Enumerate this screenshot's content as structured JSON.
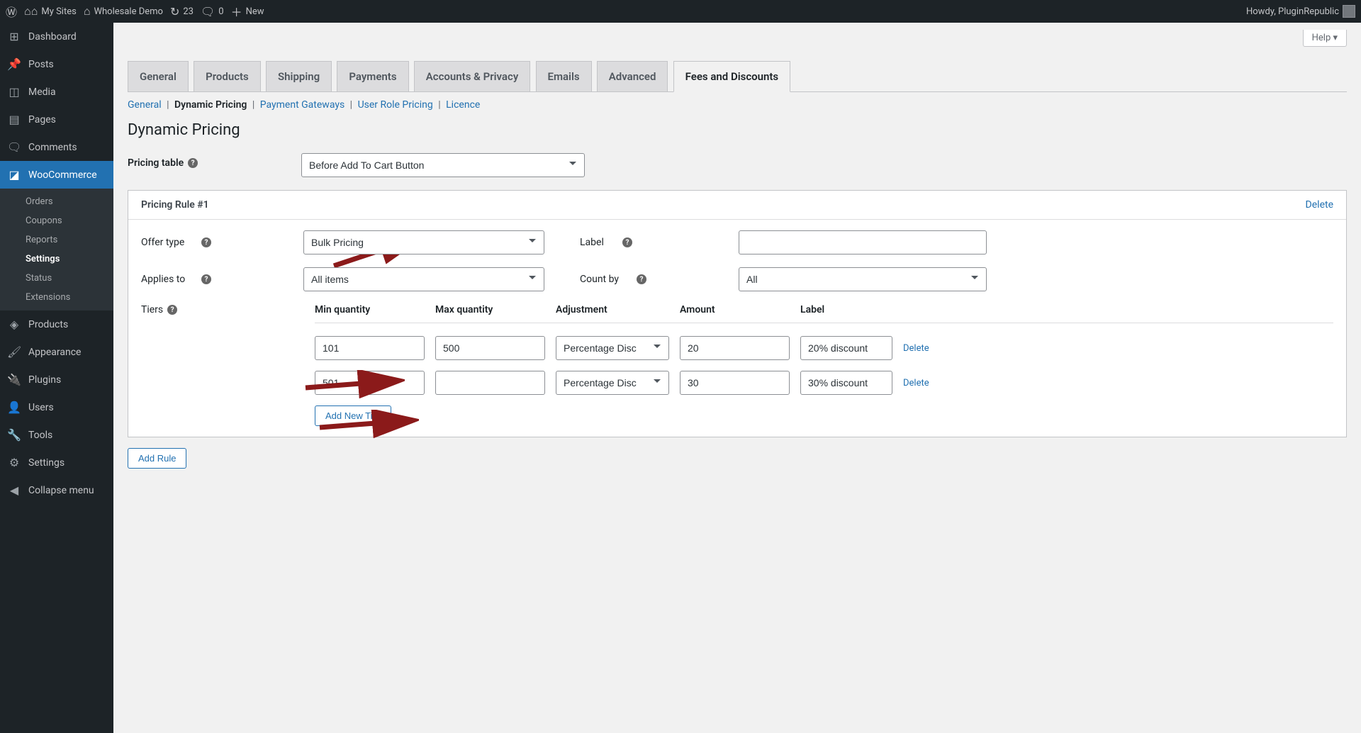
{
  "adminbar": {
    "my_sites": "My Sites",
    "site_name": "Wholesale Demo",
    "updates": "23",
    "comments": "0",
    "new": "New",
    "howdy": "Howdy, PluginRepublic"
  },
  "sidebar": {
    "dashboard": "Dashboard",
    "posts": "Posts",
    "media": "Media",
    "pages": "Pages",
    "comments": "Comments",
    "woocommerce": "WooCommerce",
    "sub": {
      "orders": "Orders",
      "coupons": "Coupons",
      "reports": "Reports",
      "settings": "Settings",
      "status": "Status",
      "extensions": "Extensions"
    },
    "products": "Products",
    "appearance": "Appearance",
    "plugins": "Plugins",
    "users": "Users",
    "tools": "Tools",
    "settings2": "Settings",
    "collapse": "Collapse menu"
  },
  "help": "Help ▾",
  "tabs": {
    "general": "General",
    "products": "Products",
    "shipping": "Shipping",
    "payments": "Payments",
    "accounts": "Accounts & Privacy",
    "emails": "Emails",
    "advanced": "Advanced",
    "fees": "Fees and Discounts"
  },
  "subnav": {
    "general": "General",
    "dynamic": "Dynamic Pricing",
    "gateways": "Payment Gateways",
    "user_role": "User Role Pricing",
    "licence": "Licence"
  },
  "page_title": "Dynamic Pricing",
  "pricing_table": {
    "label": "Pricing table",
    "value": "Before Add To Cart Button"
  },
  "rule": {
    "title": "Pricing Rule #1",
    "delete": "Delete",
    "offer_type": {
      "label": "Offer type",
      "value": "Bulk Pricing"
    },
    "rule_label": {
      "label": "Label",
      "value": ""
    },
    "applies_to": {
      "label": "Applies to",
      "value": "All items"
    },
    "count_by": {
      "label": "Count by",
      "value": "All"
    },
    "tiers": {
      "label": "Tiers",
      "headers": {
        "min": "Min quantity",
        "max": "Max quantity",
        "adj": "Adjustment",
        "amount": "Amount",
        "lbl": "Label"
      },
      "rows": [
        {
          "min": "101",
          "max": "500",
          "adj": "Percentage Disc",
          "amount": "20",
          "lbl": "20% discount",
          "delete": "Delete"
        },
        {
          "min": "501",
          "max": "",
          "adj": "Percentage Disc",
          "amount": "30",
          "lbl": "30% discount",
          "delete": "Delete"
        }
      ],
      "add": "Add New Tier"
    }
  },
  "add_rule": "Add Rule"
}
